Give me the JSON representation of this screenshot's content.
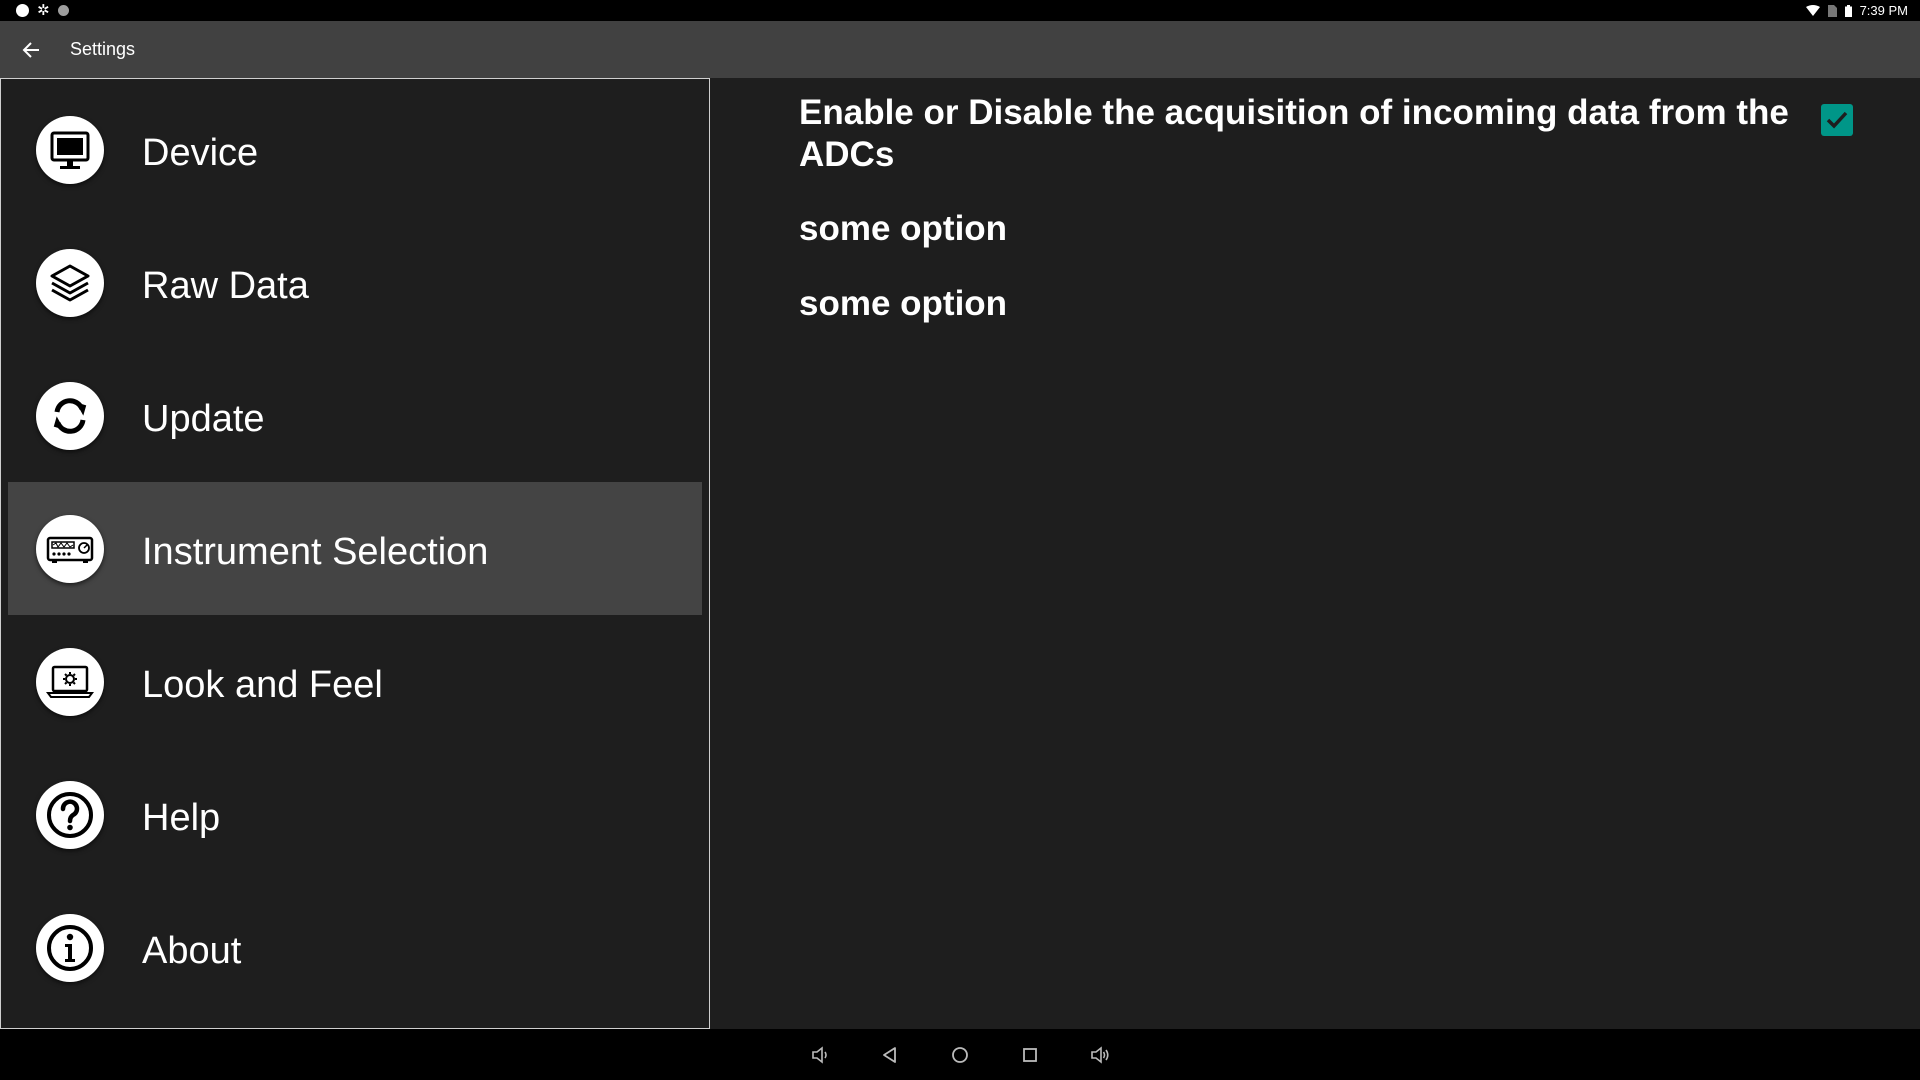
{
  "status_bar": {
    "time": "7:39 PM",
    "icons": [
      "notification-dot-icon",
      "settings-gear-icon",
      "notification-dot-icon",
      "wifi-icon",
      "no-sim-icon",
      "battery-icon"
    ]
  },
  "toolbar": {
    "title": "Settings",
    "back_icon": "arrow-left-icon"
  },
  "sidebar": {
    "items": [
      {
        "label": "Device",
        "icon": "monitor-icon",
        "selected": false
      },
      {
        "label": "Raw Data",
        "icon": "layers-icon",
        "selected": false
      },
      {
        "label": "Update",
        "icon": "sync-icon",
        "selected": false
      },
      {
        "label": "Instrument Selection",
        "icon": "instrument-device-icon",
        "selected": true
      },
      {
        "label": "Look and Feel",
        "icon": "laptop-gear-icon",
        "selected": false
      },
      {
        "label": "Help",
        "icon": "question-circle-icon",
        "selected": false
      },
      {
        "label": "About",
        "icon": "info-circle-icon",
        "selected": false
      }
    ]
  },
  "main": {
    "preferences": [
      {
        "label": "Enable or Disable the acquisition of incoming data from the ADCs",
        "checked": true
      },
      {
        "label": "some option"
      },
      {
        "label": "some option"
      }
    ]
  },
  "nav_bar": {
    "buttons": [
      "volume-down-icon",
      "back-triangle-icon",
      "home-circle-icon",
      "recents-square-icon",
      "volume-up-icon"
    ]
  },
  "colors": {
    "accent": "#009688",
    "toolbar": "#414141",
    "background": "#1e1e1e",
    "selected_item": "#444444"
  }
}
